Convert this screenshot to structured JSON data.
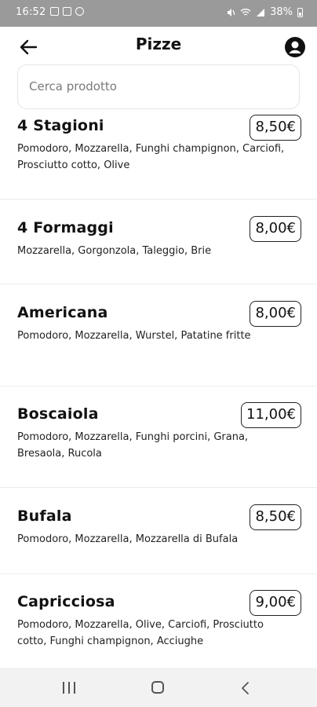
{
  "status_bar": {
    "time": "16:52",
    "battery": "38%"
  },
  "header": {
    "title": "Pizze"
  },
  "search": {
    "placeholder": "Cerca prodotto"
  },
  "products": [
    {
      "name": "4 Stagioni",
      "price": "8,50€",
      "ingredients": "Pomodoro, Mozzarella, Funghi champignon, Carciofi, Prosciutto cotto, Olive"
    },
    {
      "name": "4 Formaggi",
      "price": "8,00€",
      "ingredients": "Mozzarella, Gorgonzola, Taleggio, Brie"
    },
    {
      "name": "Americana",
      "price": "8,00€",
      "ingredients": "Pomodoro, Mozzarella, Wurstel, Patatine fritte"
    },
    {
      "name": "Boscaiola",
      "price": "11,00€",
      "ingredients": "Pomodoro, Mozzarella, Funghi porcini, Grana, Bresaola, Rucola"
    },
    {
      "name": "Bufala",
      "price": "8,50€",
      "ingredients": "Pomodoro, Mozzarella, Mozzarella di Bufala"
    },
    {
      "name": "Capricciosa",
      "price": "9,00€",
      "ingredients": "Pomodoro, Mozzarella, Olive, Carciofi, Prosciutto cotto, Funghi champignon, Acciughe"
    }
  ]
}
